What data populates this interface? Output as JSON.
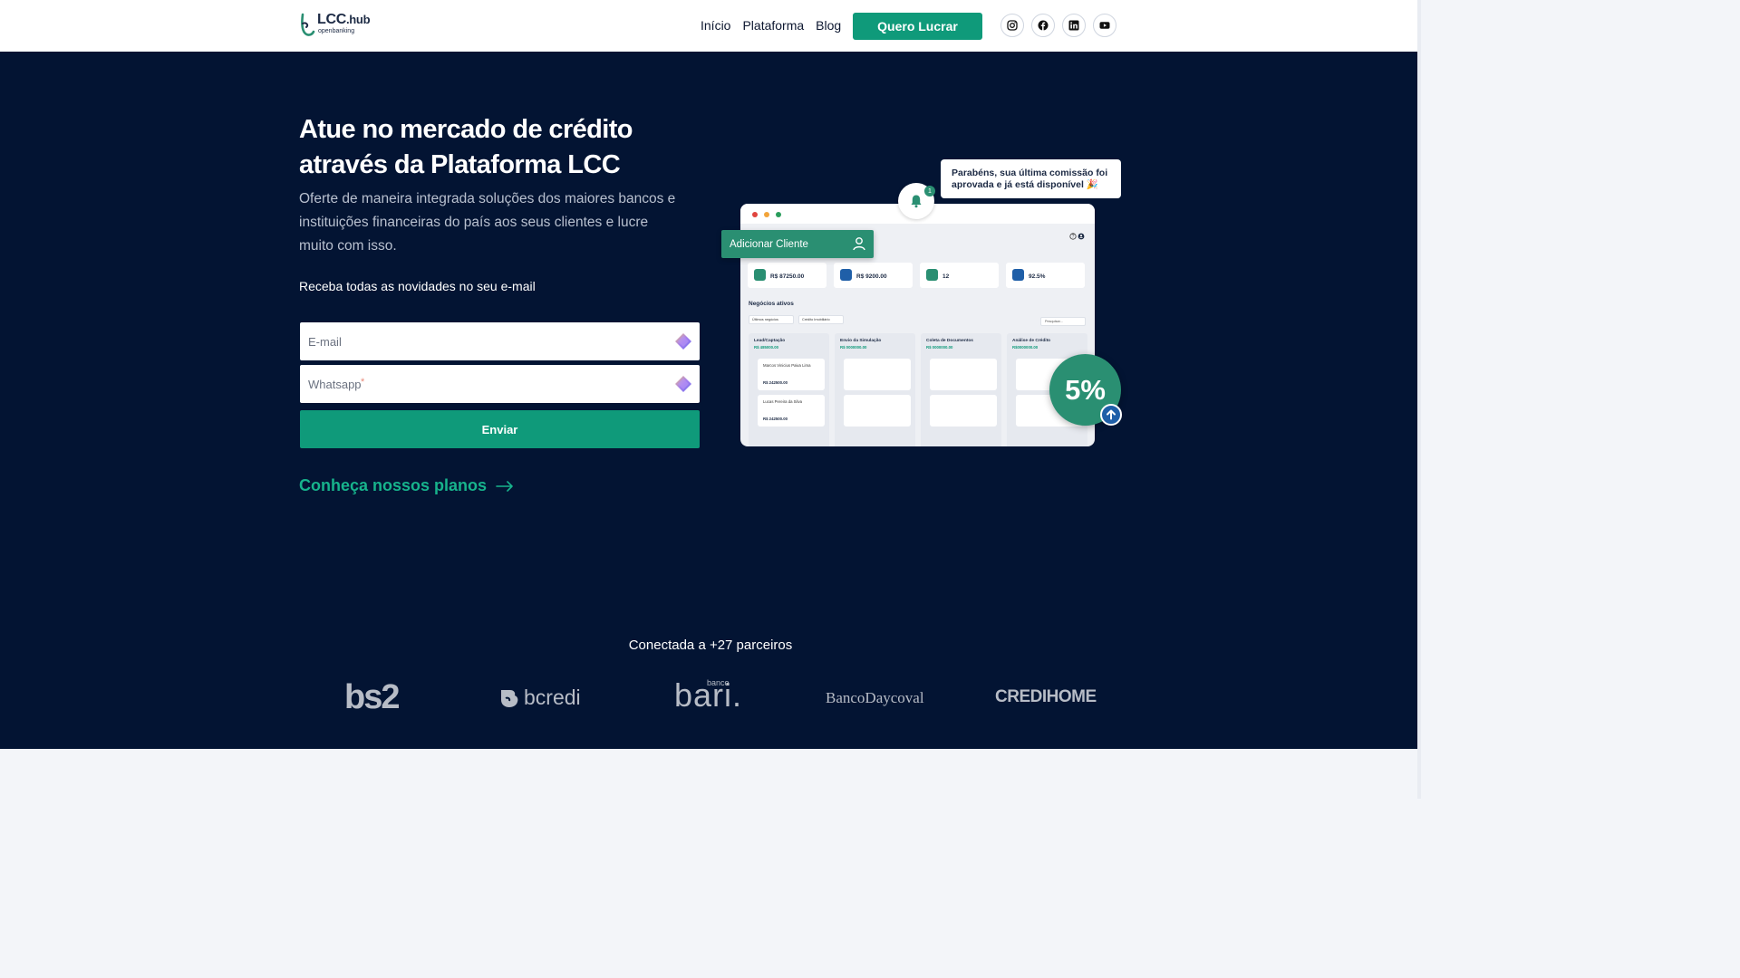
{
  "header": {
    "logo": {
      "main": "LCC",
      "suffix": ".hub",
      "sub": "openbanking"
    },
    "nav": [
      {
        "label": "Início"
      },
      {
        "label": "Plataforma"
      },
      {
        "label": "Blog"
      }
    ],
    "cta": "Quero Lucrar",
    "socials": [
      "instagram-icon",
      "facebook-icon",
      "linkedin-icon",
      "youtube-icon"
    ]
  },
  "hero": {
    "title": "Atue no mercado de crédito através da Plataforma LCC",
    "subtitle": "Oferte de maneira integrada soluções dos maiores bancos e instituições financeiras do país aos seus clientes e lucre muito com isso.",
    "newsletter_label": "Receba todas as novidades no seu e-mail",
    "form": {
      "email_placeholder": "E-mail",
      "whatsapp_placeholder": "Whatsapp",
      "whatsapp_required": "*",
      "submit": "Enviar"
    },
    "plans_link": "Conheça nossos planos"
  },
  "dashboard": {
    "add_client": "Adicionar Cliente",
    "notification": "Parabéns, sua última comissão foi aprovada e já está disponível 🎉",
    "notification_count": "1",
    "stats": [
      {
        "value": "R$ 87250.00",
        "color": "#2a8f72"
      },
      {
        "value": "R$ 9200.00",
        "color": "#1f5fa8"
      },
      {
        "value": "12",
        "color": "#2a8f72"
      },
      {
        "value": "92.5%",
        "color": "#1f5fa8"
      }
    ],
    "section_title": "Negócios ativos",
    "filters": [
      "Últimos negócios",
      "Crédito Imobiliário"
    ],
    "search": "Pesquisar...",
    "columns": [
      {
        "title": "Lead/Captação",
        "value": "R$ 485000.00"
      },
      {
        "title": "Envio da Simulação",
        "value": "R$ 0000000.00"
      },
      {
        "title": "Coleta de Documentos",
        "value": "R$ 0000000.00"
      },
      {
        "title": "Análise de Crédito",
        "value": "R$0000000.00"
      }
    ],
    "leads": [
      {
        "name": "Marcos Vinicius Paiva Lima",
        "value": "R$ 242500.00"
      },
      {
        "name": "Lucas Pereira da Silva",
        "value": "R$ 242500.00"
      }
    ],
    "percent_badge": "5%"
  },
  "partners": {
    "label": "Conectada a +27 parceiros",
    "logos": {
      "bs2": "bs2",
      "bcredi": "bcredi",
      "bari": "bari.",
      "bari_small": "banco",
      "daycoval": "BancoDaycoval",
      "credihome": "CREDIHOME"
    }
  },
  "colors": {
    "brand_green": "#0f9a7a",
    "hero_bg": "#031433",
    "link_green": "#17b38c"
  }
}
